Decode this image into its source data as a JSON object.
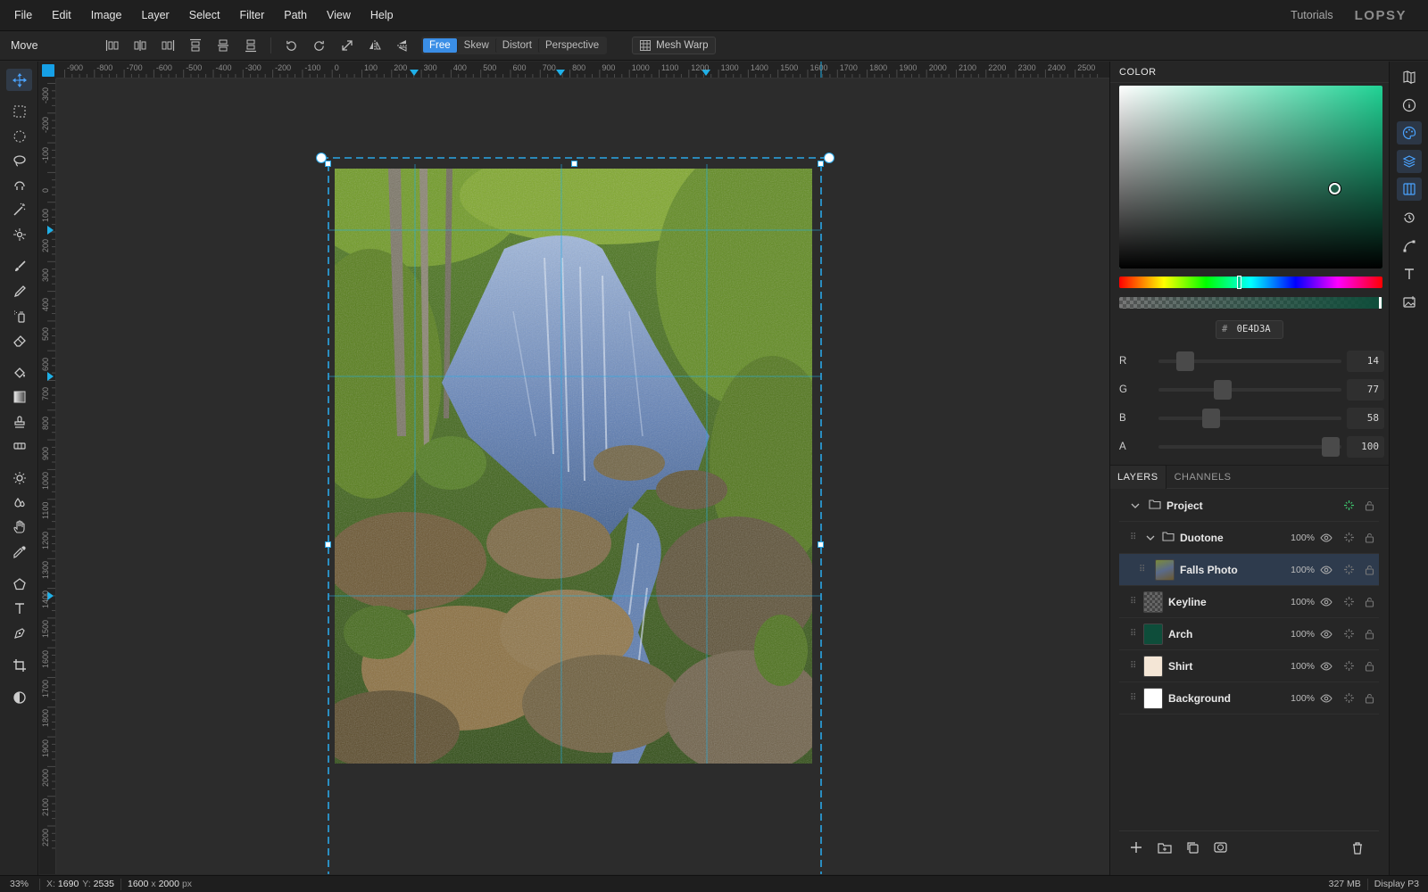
{
  "menubar": {
    "items": [
      "File",
      "Edit",
      "Image",
      "Layer",
      "Select",
      "Filter",
      "Path",
      "View",
      "Help"
    ],
    "tutorials": "Tutorials",
    "logo": "LOPSY"
  },
  "options": {
    "tool_name": "Move",
    "transform_modes": [
      "Free",
      "Skew",
      "Distort",
      "Perspective"
    ],
    "active_mode": "Free",
    "mesh_warp": "Mesh Warp"
  },
  "rulers": {
    "top": [
      "-900",
      "-800",
      "-700",
      "-600",
      "-500",
      "-400",
      "-300",
      "-200",
      "-100",
      "0",
      "100",
      "200",
      "300",
      "400",
      "500",
      "600",
      "700",
      "800",
      "900",
      "1000",
      "1100",
      "1200",
      "1300",
      "1400",
      "1500",
      "1600",
      "1700",
      "1800",
      "1900",
      "2000",
      "2100",
      "2200",
      "2300",
      "2400",
      "2500"
    ],
    "left": [
      "-300",
      "-200",
      "-100",
      "0",
      "100",
      "200",
      "300",
      "400",
      "500",
      "600",
      "700",
      "800",
      "900",
      "1000",
      "1100",
      "1200",
      "1300",
      "1400",
      "1500",
      "1600",
      "1700",
      "1800",
      "1900",
      "2000",
      "2100",
      "2200"
    ]
  },
  "color_panel": {
    "title": "COLOR",
    "hex_prefix": "#",
    "hex": "0E4D3A",
    "hue_color": "#20d294",
    "current_color": "#0E4D3A",
    "channels": [
      {
        "label": "R",
        "value": "14",
        "fraction": 0.055
      },
      {
        "label": "G",
        "value": "77",
        "fraction": 0.302
      },
      {
        "label": "B",
        "value": "58",
        "fraction": 0.227
      },
      {
        "label": "A",
        "value": "100",
        "fraction": 1.0
      }
    ]
  },
  "layers_panel": {
    "tabs": [
      "LAYERS",
      "CHANNELS"
    ],
    "active_tab": "LAYERS",
    "layers": [
      {
        "name": "Project",
        "type": "group",
        "opacity": "",
        "thumb": "none",
        "selected": false
      },
      {
        "name": "Duotone",
        "type": "group",
        "opacity": "100%",
        "thumb": "none",
        "selected": false
      },
      {
        "name": "Falls Photo",
        "type": "image",
        "opacity": "100%",
        "thumb": "#6b6a3a",
        "selected": true
      },
      {
        "name": "Keyline",
        "type": "layer",
        "opacity": "100%",
        "thumb": "checker",
        "selected": false
      },
      {
        "name": "Arch",
        "type": "layer",
        "opacity": "100%",
        "thumb": "#0E4D3A",
        "selected": false
      },
      {
        "name": "Shirt",
        "type": "layer",
        "opacity": "100%",
        "thumb": "#f4e6d6",
        "selected": false
      },
      {
        "name": "Background",
        "type": "layer",
        "opacity": "100%",
        "thumb": "#ffffff",
        "selected": false
      }
    ]
  },
  "statusbar": {
    "zoom": "33%",
    "x_label": "X:",
    "x": "1690",
    "y_label": "Y:",
    "y": "2535",
    "dims_w": "1600",
    "dims_x": "x",
    "dims_h": "2000",
    "dims_unit": "px",
    "memory": "327 MB",
    "display": "Display P3"
  },
  "colors": {
    "accent": "#3a8ee6",
    "guide": "#1fb0e8"
  }
}
